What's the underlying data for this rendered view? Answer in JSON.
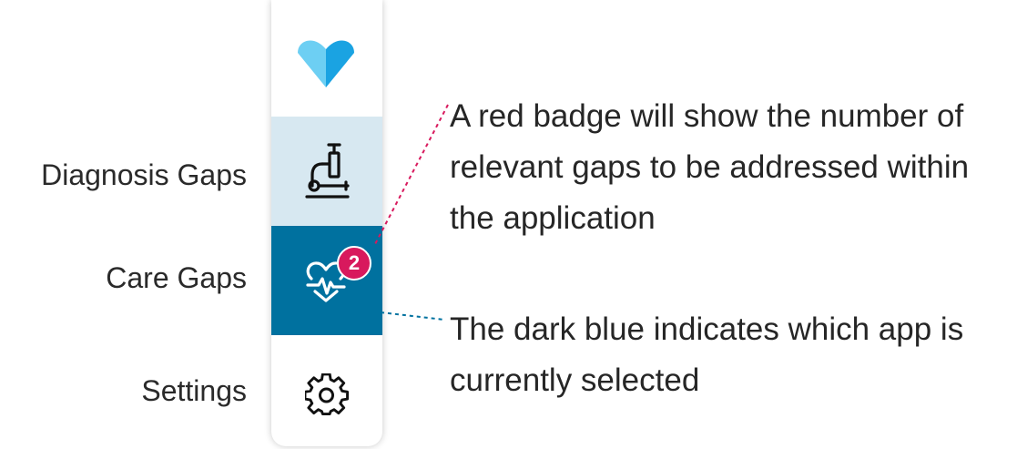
{
  "colors": {
    "light_selected": "#d7e8f1",
    "dark_selected": "#00719f",
    "badge": "#d8195d",
    "logo_light": "#6dcff3",
    "logo_dark": "#1aa3e2"
  },
  "sidebar": {
    "logo_icon": "heart-v-logo",
    "items": [
      {
        "label": "Diagnosis Gaps",
        "icon": "microscope-icon",
        "state": "hover"
      },
      {
        "label": "Care Gaps",
        "icon": "heartbeat-icon",
        "state": "selected",
        "badge": "2"
      },
      {
        "label": "Settings",
        "icon": "gear-icon",
        "state": "default"
      }
    ]
  },
  "annotations": {
    "badge_note": [
      "A red badge will show the number of",
      "relevant gaps to be addressed within",
      "the application"
    ],
    "selected_note": [
      "The dark blue indicates which app is",
      "currently selected"
    ]
  }
}
